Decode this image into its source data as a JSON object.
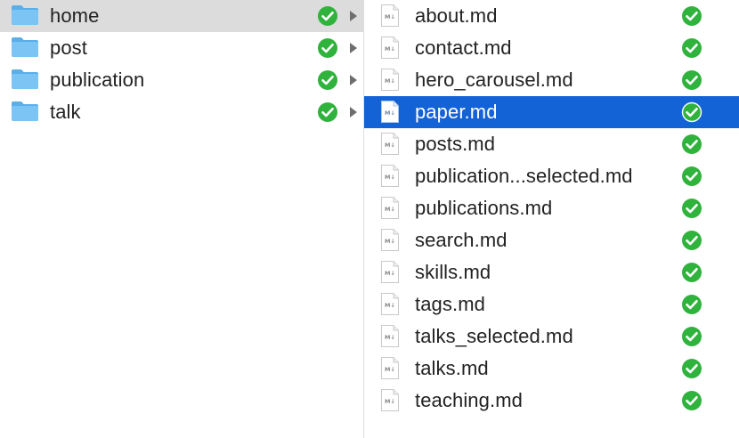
{
  "colors": {
    "folder": "#7cc4f3",
    "folder_tab": "#5aaee9",
    "sync_green": "#2fb33c",
    "selection_blue": "#1362d6",
    "selection_gray": "#dcdcdc",
    "file_badge": "#8a8a8a"
  },
  "left_column": {
    "items": [
      {
        "name": "home",
        "icon": "folder-icon",
        "status": "synced-check-icon",
        "selected": true
      },
      {
        "name": "post",
        "icon": "folder-icon",
        "status": "synced-check-icon",
        "selected": false
      },
      {
        "name": "publication",
        "icon": "folder-icon",
        "status": "synced-check-icon",
        "selected": false
      },
      {
        "name": "talk",
        "icon": "folder-icon",
        "status": "synced-check-icon",
        "selected": false
      }
    ]
  },
  "right_column": {
    "file_badge_text": "M↓",
    "items": [
      {
        "name": "about.md",
        "icon": "markdown-file-icon",
        "status": "synced-check-icon",
        "selected": false
      },
      {
        "name": "contact.md",
        "icon": "markdown-file-icon",
        "status": "synced-check-icon",
        "selected": false
      },
      {
        "name": "hero_carousel.md",
        "icon": "markdown-file-icon",
        "status": "synced-check-icon",
        "selected": false
      },
      {
        "name": "paper.md",
        "icon": "markdown-file-icon",
        "status": "synced-check-icon",
        "selected": true
      },
      {
        "name": "posts.md",
        "icon": "markdown-file-icon",
        "status": "synced-check-icon",
        "selected": false
      },
      {
        "name": "publication...selected.md",
        "icon": "markdown-file-icon",
        "status": "synced-check-icon",
        "selected": false
      },
      {
        "name": "publications.md",
        "icon": "markdown-file-icon",
        "status": "synced-check-icon",
        "selected": false
      },
      {
        "name": "search.md",
        "icon": "markdown-file-icon",
        "status": "synced-check-icon",
        "selected": false
      },
      {
        "name": "skills.md",
        "icon": "markdown-file-icon",
        "status": "synced-check-icon",
        "selected": false
      },
      {
        "name": "tags.md",
        "icon": "markdown-file-icon",
        "status": "synced-check-icon",
        "selected": false
      },
      {
        "name": "talks_selected.md",
        "icon": "markdown-file-icon",
        "status": "synced-check-icon",
        "selected": false
      },
      {
        "name": "talks.md",
        "icon": "markdown-file-icon",
        "status": "synced-check-icon",
        "selected": false
      },
      {
        "name": "teaching.md",
        "icon": "markdown-file-icon",
        "status": "synced-check-icon",
        "selected": false
      }
    ]
  }
}
